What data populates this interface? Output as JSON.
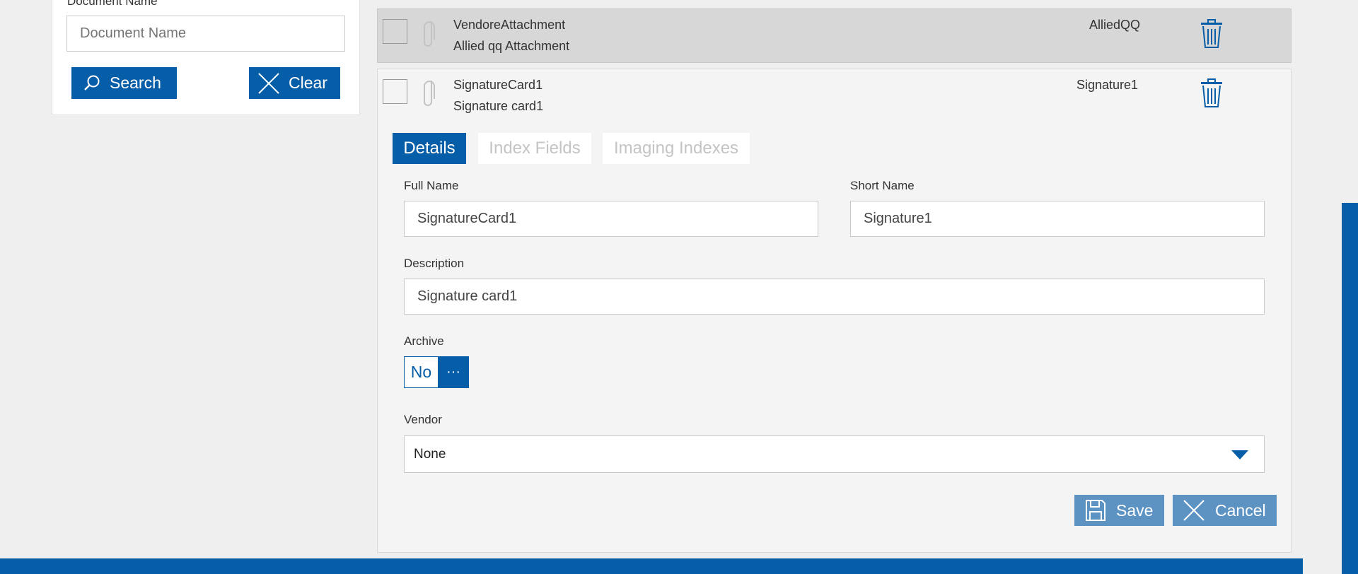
{
  "search": {
    "label": "Document Name",
    "placeholder": "Document Name",
    "search_label": "Search",
    "clear_label": "Clear"
  },
  "documents": [
    {
      "full_name": "VendoreAttachment",
      "description": "Allied qq Attachment",
      "short_name": "AlliedQQ"
    },
    {
      "full_name": "SignatureCard1",
      "description": "Signature card1",
      "short_name": "Signature1"
    }
  ],
  "tabs": [
    "Details",
    "Index Fields",
    "Imaging Indexes"
  ],
  "details": {
    "full_name_label": "Full Name",
    "full_name_value": "SignatureCard1",
    "short_name_label": "Short Name",
    "short_name_value": "Signature1",
    "description_label": "Description",
    "description_value": "Signature card1",
    "archive_label": "Archive",
    "archive_value": "No",
    "archive_more": "···",
    "vendor_label": "Vendor",
    "vendor_value": "None"
  },
  "actions": {
    "save_label": "Save",
    "cancel_label": "Cancel"
  },
  "icons": [
    "search-icon",
    "close-icon",
    "paperclip-icon",
    "trash-icon",
    "save-icon",
    "caret-down-icon"
  ],
  "colors": {
    "primary": "#075ea8",
    "secondary_button": "#5d93c3",
    "selected_row": "#d7d7d7"
  }
}
